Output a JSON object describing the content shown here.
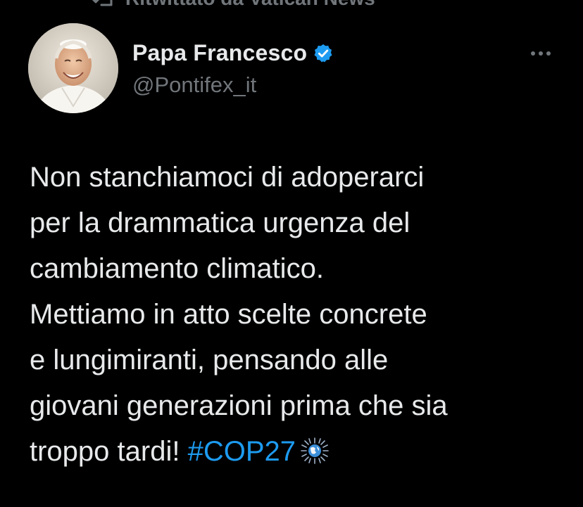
{
  "retweet": {
    "label": "Ritwittato da Vatican News"
  },
  "author": {
    "display_name": "Papa Francesco",
    "handle": "@Pontifex_it",
    "verified": true
  },
  "tweet": {
    "lines": [
      "Non stanchiamoci di adoperarci",
      "per la drammatica urgenza del",
      "cambiamento climatico.",
      "Mettiamo in atto scelte concrete",
      "e lungimiranti, pensando alle",
      "giovani generazioni prima che sia",
      "troppo tardi! "
    ],
    "hashtag": "#COP27",
    "emoji_icon": "earth-sunburst-icon"
  },
  "colors": {
    "background": "#000000",
    "text": "#e7e9ea",
    "secondary": "#71767b",
    "accent": "#1d9bf0"
  }
}
